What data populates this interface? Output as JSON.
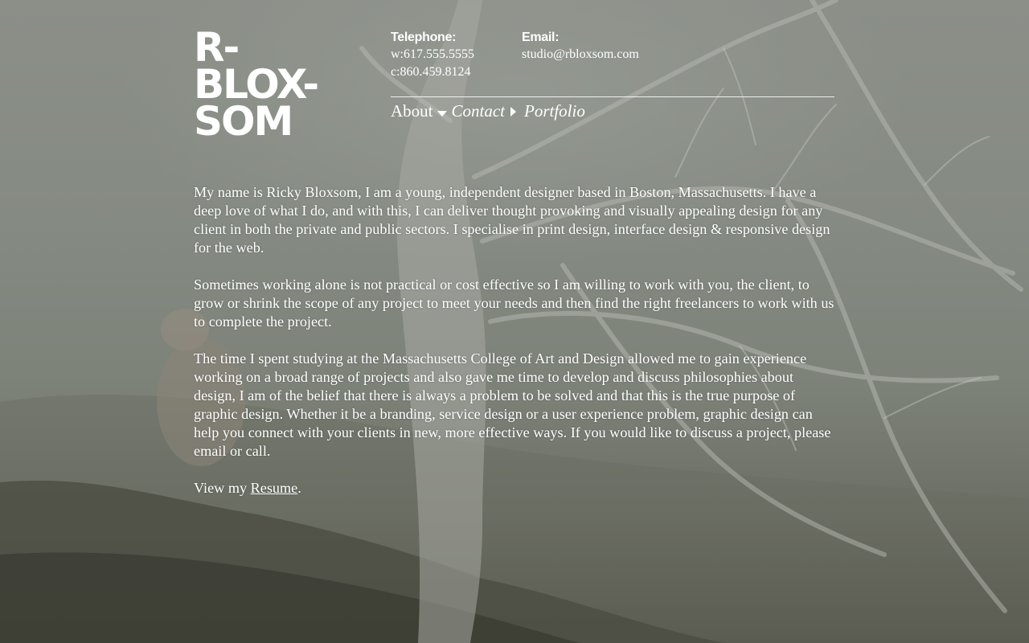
{
  "logo": {
    "text": "R-\nBLOX-\nSOM"
  },
  "contact": {
    "telephone_label": "Telephone:",
    "telephone_work": "w:617.555.5555",
    "telephone_cell": "c:860.459.8124",
    "email_label": "Email:",
    "email": "studio@rbloxsom.com"
  },
  "nav": {
    "items": [
      {
        "label": "About",
        "icon": "caret-down-icon",
        "active": true
      },
      {
        "label": "Contact",
        "icon": "caret-right-icon",
        "active": false
      },
      {
        "label": "Portfolio",
        "active": false
      }
    ]
  },
  "content": {
    "paragraphs": [
      "My name is Ricky Bloxsom, I am a young, independent designer based in Boston, Massachusetts. I have a deep love of what I do, and with this, I can deliver thought provoking and visually appealing design for any client in both the private and public sectors. I specialise in print design, interface design & responsive design for the web.",
      "Sometimes working alone is not practical or cost effective so I am willing to work with you, the client, to grow or shrink the scope of any project to meet your needs and then find the right freelancers to work with us to complete the project.",
      "The time I spent studying at the Massachusetts College of Art and Design allowed me to gain experience working on a broad range of projects and also gave me time to develop and discuss philosophies about design, I am of the belief that there is always a problem to be solved and that this is the true purpose of graphic design. Whether it be a branding, service design or a user experience problem, graphic design can help you connect with your clients in new, more effective ways. If you would like to discuss a project, please email or call."
    ],
    "resume_prefix": "View my ",
    "resume_link": "Resume",
    "resume_suffix": "."
  },
  "colors": {
    "text": "#ffffff",
    "background": "#7d827b"
  }
}
